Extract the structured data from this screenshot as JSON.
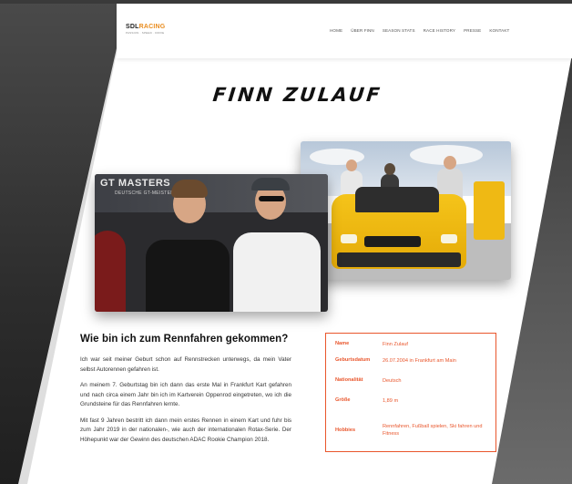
{
  "brand": {
    "name_part1": "SDL",
    "name_part2": "RACING",
    "tagline": "PASSION · SPEED · DRIVE"
  },
  "nav": {
    "items": [
      {
        "label": "HOME"
      },
      {
        "label": "ÜBER FINN"
      },
      {
        "label": "SEASON STATS"
      },
      {
        "label": "RACE HISTORY"
      },
      {
        "label": "PRESSE"
      },
      {
        "label": "KONTAKT"
      }
    ]
  },
  "page": {
    "title": "FINN ZULAUF"
  },
  "photos": {
    "left_banner": "GT MASTERS",
    "left_banner_sub": "DEUTSCHE GT-MEISTERSCHAFT"
  },
  "intro": {
    "heading": "Wie bin ich zum Rennfahren gekommen?",
    "paragraphs": [
      "Ich war seit meiner Geburt schon auf Rennstrecken unterwegs, da mein Vater selbst Autorennen gefahren ist.",
      "An meinem 7. Geburtstag bin ich dann das erste Mal in Frankfurt Kart gefahren und nach circa einem Jahr bin ich im Kartverein Oppenrod eingetreten, wo ich die Grundsteine für das Rennfahren lernte.",
      "Mit fast 9 Jahren bestritt ich dann mein erstes Rennen in einem Kart und fuhr bis zum Jahr 2019 in der nationalen-, wie auch der internationalen Rotax-Serie. Der Höhepunkt war der Gewinn des deutschen ADAC Rookie Champion 2018."
    ]
  },
  "info": {
    "rows": [
      {
        "label": "Name",
        "value": "Finn Zulauf"
      },
      {
        "label": "Geburtsdatum",
        "value": "26.07.2004 in Frankfurt am Main"
      },
      {
        "label": "Nationalität",
        "value": "Deutsch"
      },
      {
        "label": "Größe",
        "value": "1,89 m"
      },
      {
        "label": "Hobbies",
        "value": "Rennfahren, Fußball spielen, Ski fahren und Fitness"
      }
    ]
  },
  "colors": {
    "accent": "#e9562c",
    "brand_orange": "#e98c1e"
  }
}
